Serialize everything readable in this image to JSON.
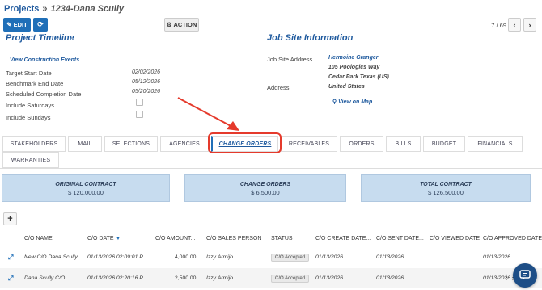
{
  "breadcrumb": {
    "root": "Projects",
    "separator": "»",
    "current": "1234-Dana Scully"
  },
  "toolbar": {
    "edit_label": "EDIT",
    "action_label": "ACTION",
    "pager": "7 / 69"
  },
  "timeline": {
    "title": "Project Timeline",
    "view_events": "View Construction Events",
    "rows": [
      {
        "label": "Target Start Date",
        "value": "02/02/2026"
      },
      {
        "label": "Benchmark End Date",
        "value": "05/12/2026"
      },
      {
        "label": "Scheduled Completion Date",
        "value": "05/20/2026"
      },
      {
        "label": "Include Saturdays",
        "value": ""
      },
      {
        "label": "Include Sundays",
        "value": ""
      }
    ]
  },
  "jobsite": {
    "title": "Job Site Information",
    "address_label": "Job Site Address",
    "contact": "Hermoine Granger",
    "street": "105 Poologics Way",
    "city": "Cedar Park  Texas (US)",
    "addr_label": "Address",
    "country": "United States",
    "map_link": "View on Map"
  },
  "tabs": [
    "STAKEHOLDERS",
    "MAIL",
    "SELECTIONS",
    "AGENCIES",
    "CHANGE ORDERS",
    "RECEIVABLES",
    "ORDERS",
    "BILLS",
    "BUDGET",
    "FINANCIALS",
    "WARRANTIES"
  ],
  "cards": [
    {
      "title": "ORIGINAL CONTRACT",
      "value": "$ 120,000.00"
    },
    {
      "title": "CHANGE ORDERS",
      "value": "$ 6,500.00"
    },
    {
      "title": "TOTAL CONTRACT",
      "value": "$ 126,500.00"
    }
  ],
  "add_label": "+",
  "table": {
    "headers": [
      "C/O NAME",
      "C/O DATE",
      "C/O AMOUNT...",
      "C/O SALES PERSON",
      "STATUS",
      "C/O CREATE DATE...",
      "C/O SENT DATE...",
      "C/O VIEWED DATE",
      "C/O APPROVED DATE"
    ],
    "rows": [
      {
        "name": "New C/O Dana Scully",
        "date": "01/13/2026 02:09:01 P...",
        "amount": "4,000.00",
        "sales": "Izzy Armijo",
        "status": "C/O Accepted",
        "create": "01/13/2026",
        "sent": "01/13/2026",
        "viewed": "",
        "approved": "01/13/2026"
      },
      {
        "name": "Dana Scully C/O",
        "date": "01/13/2026 02:20:16 P...",
        "amount": "2,500.00",
        "sales": "Izzy Armijo",
        "status": "C/O Accepted",
        "create": "01/13/2026",
        "sent": "01/13/2026",
        "viewed": "",
        "approved": "01/13/2026"
      }
    ]
  },
  "colors": {
    "accent": "#1f6fb8",
    "link": "#1f5a9e",
    "highlight": "#e53a2c",
    "card": "#c7dcef"
  }
}
